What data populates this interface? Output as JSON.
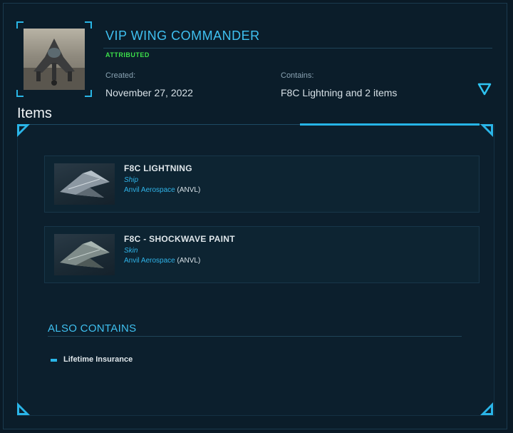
{
  "pledge": {
    "title": "VIP WING COMMANDER",
    "status": "ATTRIBUTED",
    "created_label": "Created:",
    "created_value": "November 27, 2022",
    "contains_label": "Contains:",
    "contains_value": "F8C Lightning and 2 items"
  },
  "items_heading": "Items",
  "items": [
    {
      "name": "F8C LIGHTNING",
      "kind": "Ship",
      "manufacturer": "Anvil Aerospace",
      "code": "(ANVL)"
    },
    {
      "name": "F8C - SHOCKWAVE PAINT",
      "kind": "Skin",
      "manufacturer": "Anvil Aerospace",
      "code": "(ANVL)"
    }
  ],
  "also_contains": {
    "heading": "ALSO CONTAINS",
    "items": [
      "Lifetime Insurance"
    ]
  },
  "colors": {
    "accent": "#3fc0f0",
    "attributed": "#3ce04a",
    "background": "#0b1d2a"
  },
  "icons": {
    "toggle": "triangle-down-icon"
  }
}
